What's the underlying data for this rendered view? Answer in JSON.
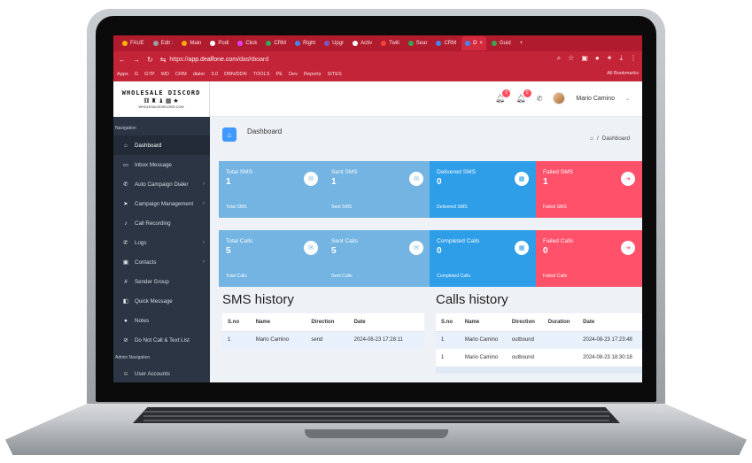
{
  "browser": {
    "tabs": [
      {
        "label": "FAUE",
        "dot": "#ffb400"
      },
      {
        "label": "Edit :",
        "dot": "#9aa0a6"
      },
      {
        "label": "Main",
        "dot": "#f9ab00"
      },
      {
        "label": "Podi",
        "dot": "#ffffff"
      },
      {
        "label": "Click",
        "dot": "#e040fb"
      },
      {
        "label": "CRM",
        "dot": "#34a853"
      },
      {
        "label": "Right",
        "dot": "#4285f4"
      },
      {
        "label": "Upgr",
        "dot": "#7e57c2"
      },
      {
        "label": "Activ",
        "dot": "#ffffff"
      },
      {
        "label": "Twili",
        "dot": "#f44336"
      },
      {
        "label": "Sear",
        "dot": "#34a853"
      },
      {
        "label": "CRM",
        "dot": "#4285f4"
      },
      {
        "label": "D",
        "dot": "#4285f4",
        "active": true
      },
      {
        "label": "Guid",
        "dot": "#34a853"
      }
    ],
    "new_tab": "+",
    "url_prefix": "https://",
    "url_host": "app.dealfone.com",
    "url_path": "/dashboard",
    "bookmarks": [
      "Apps",
      "G",
      "GTP",
      "WD",
      "CRM",
      "dialer",
      "3.0",
      "DBN/DDN",
      "TOOLS",
      "PE",
      "Dev",
      "Reports",
      "SITES"
    ],
    "all_bookmarks": "All Bookmarks"
  },
  "logo": {
    "title": "WHOLESALE DISCORD",
    "icons": "⚅ ♜ ♝ ▦ ★",
    "subtitle": "WHOLESALEDISCORD.COM"
  },
  "sidebar": {
    "nav_label": "Navigation",
    "items": [
      {
        "icon": "home-icon",
        "glyph": "⌂",
        "label": "Dashboard",
        "active": true,
        "chevron": false
      },
      {
        "icon": "inbox-icon",
        "glyph": "▭",
        "label": "Inbox Message",
        "chevron": false
      },
      {
        "icon": "phone-icon",
        "glyph": "✆",
        "label": "Auto Campaign Dialer",
        "chevron": true
      },
      {
        "icon": "send-icon",
        "glyph": "➤",
        "label": "Campaign Management",
        "chevron": true
      },
      {
        "icon": "microphone-icon",
        "glyph": "♪",
        "label": "Call Recording",
        "chevron": false
      },
      {
        "icon": "phone-log-icon",
        "glyph": "✆",
        "label": "Logs",
        "chevron": true
      },
      {
        "icon": "contacts-icon",
        "glyph": "▣",
        "label": "Contacts",
        "chevron": true
      },
      {
        "icon": "hash-icon",
        "glyph": "#",
        "label": "Sender Group",
        "chevron": false
      },
      {
        "icon": "quick-message-icon",
        "glyph": "◧",
        "label": "Quick Message",
        "chevron": false
      },
      {
        "icon": "notes-icon",
        "glyph": "●",
        "label": "Notes",
        "chevron": false
      },
      {
        "icon": "block-icon",
        "glyph": "⊘",
        "label": "Do Not Call & Text List",
        "chevron": false
      }
    ],
    "admin_label": "Admin Navigation",
    "admin_items": [
      {
        "icon": "users-icon",
        "glyph": "☺",
        "label": "User Accounts"
      }
    ]
  },
  "topbar": {
    "notif_count_1": "0",
    "notif_count_2": "0",
    "user_name": "Mario Camino",
    "chevron": "⌄"
  },
  "page": {
    "title": "Dashboard",
    "breadcrumb_home": "⌂",
    "breadcrumb_sep": "/",
    "breadcrumb_current": "Dashboard"
  },
  "colors": {
    "total": "#73b4e2",
    "sent": "#73b4e2",
    "delivered": "#2e9ee8",
    "failed": "#ff526a"
  },
  "sms_cards": [
    {
      "title": "Total SMS",
      "value": "1",
      "footer": "Total SMS",
      "icon": "envelope-icon",
      "glyph": "✉",
      "color": "#73b4e2"
    },
    {
      "title": "Sent SMS",
      "value": "1",
      "footer": "Sent SMS",
      "icon": "envelope-icon",
      "glyph": "✉",
      "color": "#73b4e2"
    },
    {
      "title": "Delivered SMS",
      "value": "0",
      "footer": "Delivered SMS",
      "icon": "calendar-icon",
      "glyph": "▦",
      "color": "#2e9ee8"
    },
    {
      "title": "Failed SMS",
      "value": "1",
      "footer": "Failed SMS",
      "icon": "sign-in-icon",
      "glyph": "➔",
      "color": "#ff526a"
    }
  ],
  "call_cards": [
    {
      "title": "Total Calls",
      "value": "5",
      "footer": "Total Calls",
      "icon": "envelope-icon",
      "glyph": "✉",
      "color": "#73b4e2"
    },
    {
      "title": "Sent Calls",
      "value": "5",
      "footer": "Sent Calls",
      "icon": "envelope-icon",
      "glyph": "✉",
      "color": "#73b4e2"
    },
    {
      "title": "Completed Calls",
      "value": "0",
      "footer": "Completed Calls",
      "icon": "calendar-icon",
      "glyph": "▦",
      "color": "#2e9ee8"
    },
    {
      "title": "Failed Calls",
      "value": "0",
      "footer": "Failed Calls",
      "icon": "sign-in-icon",
      "glyph": "➔",
      "color": "#ff526a"
    }
  ],
  "sms_history": {
    "title": "SMS history",
    "columns": [
      "S.no",
      "Name",
      "Direction",
      "Date"
    ],
    "rows": [
      [
        "1",
        "Mario Camino",
        "send",
        "2024-08-23 17:28:11"
      ]
    ]
  },
  "calls_history": {
    "title": "Calls history",
    "columns": [
      "S.no",
      "Name",
      "Direction",
      "Duration",
      "Date"
    ],
    "rows": [
      [
        "1",
        "Mario Camino",
        "outbound",
        "",
        "2024-08-23 17:23:48"
      ],
      [
        "1",
        "Mario Camino",
        "outbound",
        "",
        "2024-08-23 18:30:18"
      ]
    ]
  }
}
